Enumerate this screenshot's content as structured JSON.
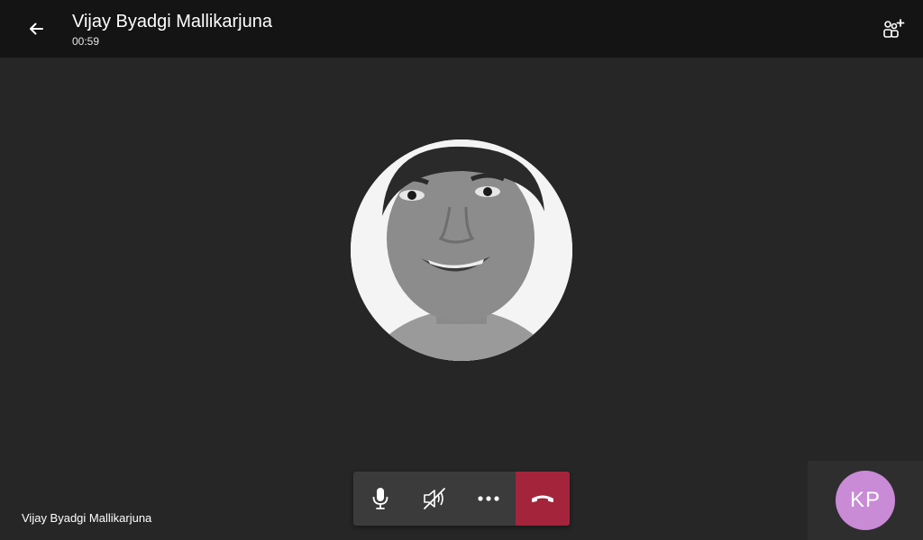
{
  "header": {
    "title": "Vijay Byadgi Mallikarjuna",
    "timer": "00:59"
  },
  "icons": {
    "back": "arrow-left-icon",
    "add_people": "add-people-icon",
    "mic": "microphone-icon",
    "speaker": "speaker-muted-icon",
    "more": "more-options-icon",
    "hangup": "hang-up-icon"
  },
  "participant": {
    "name": "Vijay Byadgi Mallikarjuna"
  },
  "self": {
    "initials": "KP",
    "avatar_color": "#c98ad6"
  },
  "colors": {
    "background": "#262626",
    "header": "#141414",
    "controls": "#3b3b3b",
    "hangup": "#a4243b"
  }
}
